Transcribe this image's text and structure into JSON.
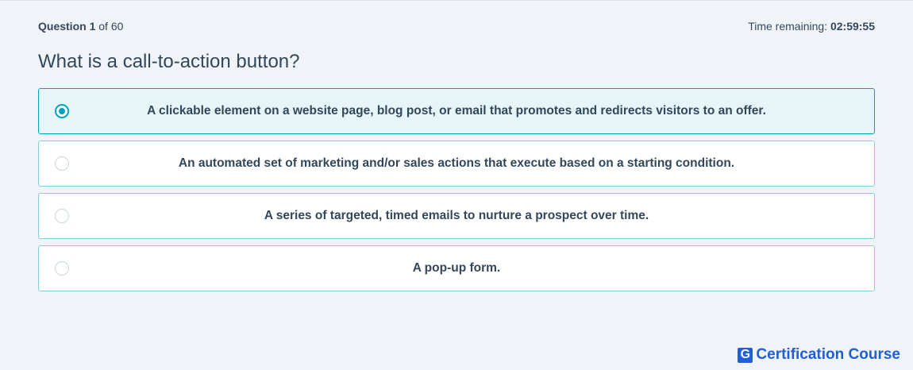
{
  "header": {
    "question_label": "Question",
    "question_number": "1",
    "question_of": "of 60",
    "time_label": "Time remaining:",
    "time_value": "02:59:55"
  },
  "question": {
    "text": "What is a call-to-action button?"
  },
  "options": [
    {
      "text": "A clickable element on a website page, blog post, or email that promotes and redirects visitors to an offer.",
      "selected": true
    },
    {
      "text": "An automated set of marketing and/or sales actions that execute based on a starting condition.",
      "selected": false
    },
    {
      "text": "A series of targeted, timed emails to nurture a prospect over time.",
      "selected": false
    },
    {
      "text": "A pop-up form.",
      "selected": false
    }
  ],
  "brand": {
    "logo_letter": "G",
    "name": "Certification Course",
    "color": "#1f5ed6"
  },
  "colors": {
    "accent": "#00a4bd",
    "text": "#33475b",
    "selected_bg": "#e5f5f8"
  }
}
